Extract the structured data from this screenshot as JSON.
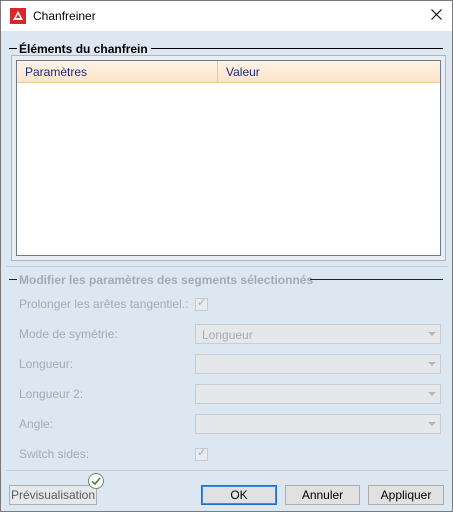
{
  "window": {
    "title": "Chanfreiner",
    "close_icon": "close-icon",
    "app_icon": "chamfer-app-icon"
  },
  "elements_group": {
    "title": "Éléments du chanfrein",
    "columns": [
      "Paramètres",
      "Valeur"
    ]
  },
  "modify_group": {
    "title": "Modifier les paramètres des segments sélectionnés",
    "extend_tangential": {
      "label": "Prolonger les arêtes tangentiel.:",
      "checked": true
    },
    "symmetry_mode": {
      "label": "Mode de symétrie:",
      "value": "Longueur"
    },
    "length": {
      "label": "Longueur:",
      "value": ""
    },
    "length2": {
      "label": "Longueur 2:",
      "value": ""
    },
    "angle": {
      "label": "Angle:",
      "value": ""
    },
    "switch_sides": {
      "label": "Switch sides:",
      "checked": true
    }
  },
  "buttons": {
    "preview": "Prévisualisation",
    "ok": "OK",
    "cancel": "Annuler",
    "apply": "Appliquer"
  }
}
